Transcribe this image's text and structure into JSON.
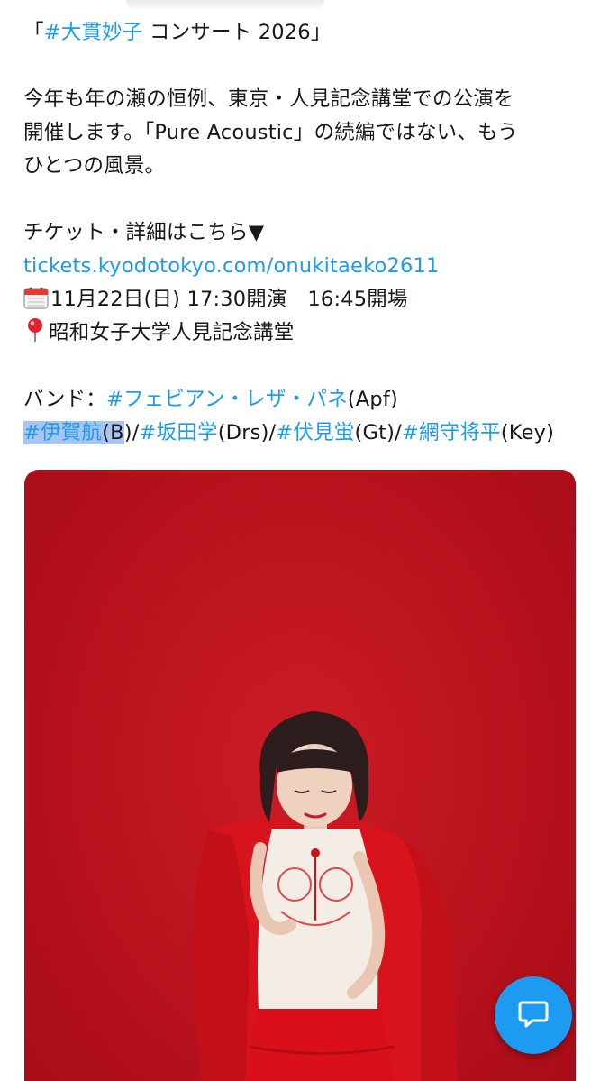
{
  "tweet": {
    "title_open": "「",
    "title_tag": "#大貫妙子",
    "title_rest": " コンサート 2026」",
    "body_line1": "今年も年の瀬の恒例、東京・人見記念講堂での公演を",
    "body_line2": "開催します。「Pure Acoustic」の続編ではない、もう",
    "body_line3": "ひとつの風景。",
    "ticket_label": "チケット・詳細はこちら▼",
    "ticket_link": "tickets.kyodotokyo.com/onukitaeko2611",
    "date_text": "11月22日(日) 17:30開演　16:45開場",
    "venue_text": "昭和女子大学人見記念講堂",
    "band_label": "バンド：",
    "band": [
      {
        "tag": "#フェビアン・レザ・パネ",
        "role": "(Apf)"
      },
      {
        "tag_sel": "#伊賀航",
        "tag_sel2": "(B",
        "role": ")/"
      },
      {
        "tag": "#坂田学",
        "role": "(Drs)/"
      },
      {
        "tag": "#伏見蛍",
        "role": "(Gt)/"
      },
      {
        "tag": "#網守将平",
        "role": "(Key)"
      }
    ]
  },
  "icons": {
    "calendar": "calendar-icon",
    "pin": "pin-icon",
    "compose": "compose-reply-icon"
  },
  "colors": {
    "link": "#1d9bf0",
    "text": "#16181c",
    "selection": "#a9c4f0",
    "photo_bg": "#c0141f"
  }
}
